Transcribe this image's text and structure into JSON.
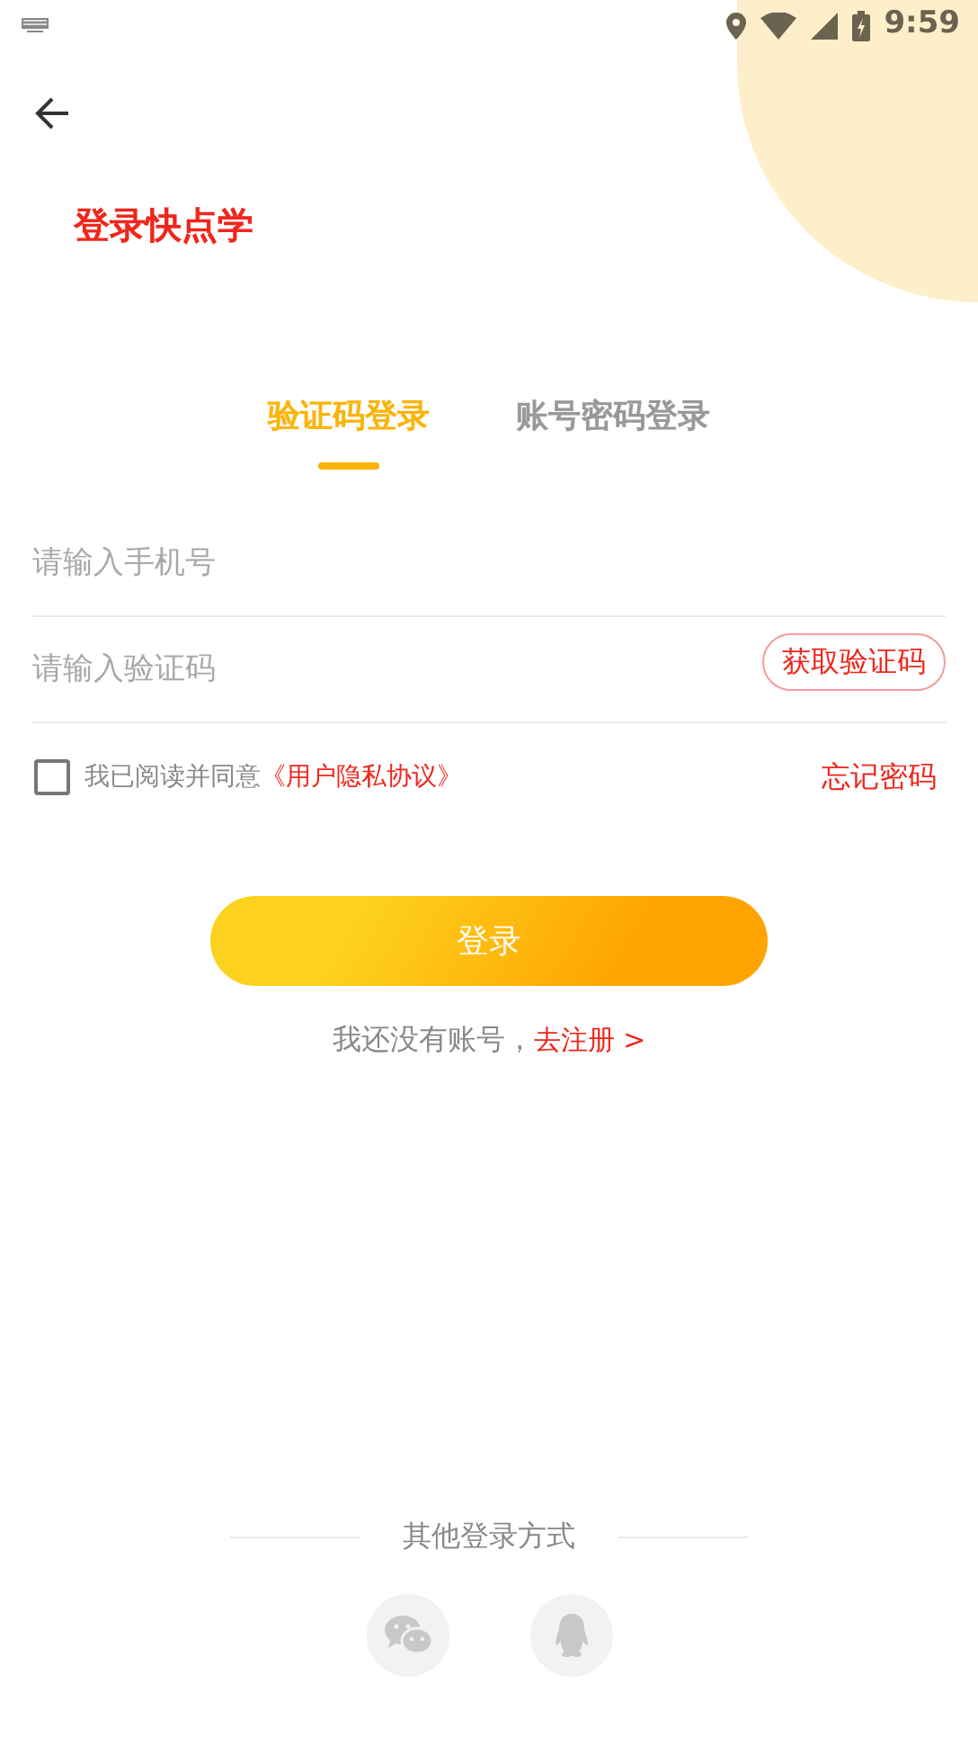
{
  "status_bar": {
    "time": "9:59"
  },
  "title": "登录快点学",
  "tabs": [
    {
      "label": "验证码登录",
      "selected": true
    },
    {
      "label": "账号密码登录",
      "selected": false
    }
  ],
  "fields": [
    {
      "placeholder": "请输入手机号"
    },
    {
      "placeholder": "请输入验证码",
      "button": "获取验证码"
    }
  ],
  "agreement": {
    "checked": false,
    "text": "我已阅读并同意",
    "link": "《用户隐私协议》"
  },
  "forgot_password": "忘记密码",
  "login_button": "登录",
  "register": {
    "text": "我还没有账号，",
    "link": "去注册 >"
  },
  "other_login": {
    "label": "其他登录方式",
    "methods": [
      {
        "kind": "wechat"
      },
      {
        "kind": "qq"
      }
    ]
  }
}
